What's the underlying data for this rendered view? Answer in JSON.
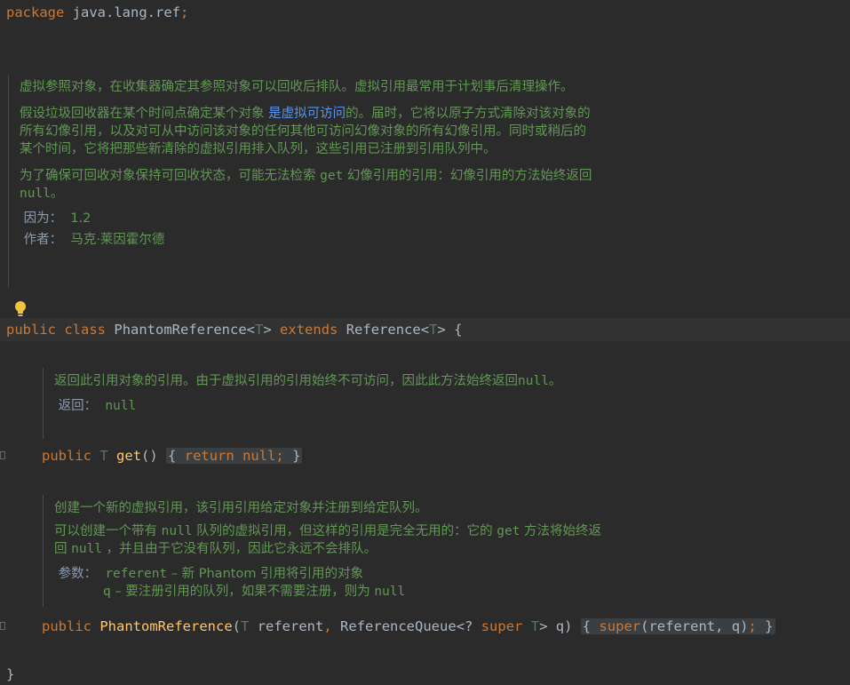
{
  "code": {
    "package_kw": "package",
    "package_name": "java.lang.ref",
    "semicolon": ";",
    "class_line": {
      "public": "public",
      "class": "class",
      "name": "PhantomReference",
      "lt1": "<",
      "t1": "T",
      "gt1": ">",
      "extends": "extends",
      "super_name": "Reference",
      "lt2": "<",
      "t2": "T",
      "gt2": ">",
      "brace": "{"
    },
    "get_line": {
      "public": "public",
      "type": "T",
      "name": "get",
      "parens": "()",
      "open": "{",
      "return": "return",
      "null": "null",
      "semi": ";",
      "close": "}"
    },
    "ctor_line": {
      "public": "public",
      "name": "PhantomReference",
      "open_paren": "(",
      "t": "T",
      "p1": "referent",
      "comma": ",",
      "rq": "ReferenceQueue",
      "wild": "<?",
      "super_kw": "super",
      "t2": "T",
      "gt": ">",
      "p2": "q",
      "close_paren": ")",
      "open": "{",
      "super_call": "super",
      "args": "(referent, q)",
      "semi": ";",
      "close": "}"
    },
    "closing_brace": "}"
  },
  "class_doc": {
    "para1": "虚拟参照对象，在收集器确定其参照对象可以回收后排队。虚拟引用最常用于计划事后清理操作。",
    "para2_before": "假设垃圾回收器在某个时间点确定某个对象 ",
    "para2_link": "是虚拟可访问",
    "para2_after": "的。届时，它将以原子方式清除对该对象的所有幻像引用，以及对可从中访问该对象的任何其他可访问幻像对象的所有幻像引用。同时或稍后的某个时间，它将把那些新清除的虚拟引用排入队列，这些引用已注册到引用队列中。",
    "para3_a": "为了确保可回收对象保持可回收状态，可能无法检索 ",
    "para3_get": "get",
    "para3_b": " 幻像引用的引用：幻像引用的方法始终返回 ",
    "para3_null": "null",
    "para3_c": "。",
    "since_label": "因为：",
    "since_value": "1.2",
    "author_label": "作者：",
    "author_value": "马克·莱因霍尔德"
  },
  "get_doc": {
    "text_a": "返回此引用对象的引用。由于虚拟引用的引用始终不可访问，因此此方法始终返回",
    "text_null": "null",
    "text_b": "。",
    "returns_label": "返回：",
    "returns_value": "null"
  },
  "ctor_doc": {
    "para1": "创建一个新的虚拟引用，该引用引用给定对象并注册到给定队列。",
    "para2_a": "可以创建一个带有 ",
    "para2_null1": "null",
    "para2_b": " 队列的虚拟引用，但这样的引用是完全无用的：它的 ",
    "para2_get": "get",
    "para2_c": " 方法将始终返回 ",
    "para2_null2": "null",
    "para2_d": " ，并且由于它没有队列，因此它永远不会排队。",
    "params_label": "参数：",
    "param1_name": "referent",
    "param1_desc": " – 新 Phantom 引用将引用的对象",
    "param2_name": "q",
    "param2_desc": " – 要注册引用的队列，如果不需要注册，则为 ",
    "param2_null": "null"
  },
  "icons": {
    "bulb": "lightbulb-icon",
    "fold": "fold-marker-icon"
  },
  "colors": {
    "background": "#2b2b2b",
    "keyword": "#cc7832",
    "doc": "#629755",
    "method": "#ffc66d",
    "link": "#5994f0"
  }
}
